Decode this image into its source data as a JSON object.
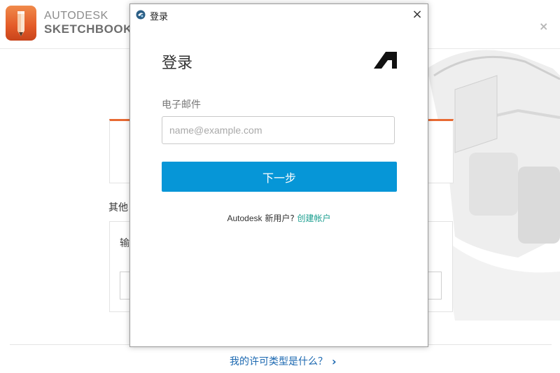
{
  "app": {
    "brand_line1": "AUTODESK",
    "brand_line2": "SKETCHBOOK",
    "close_glyph": "×"
  },
  "background": {
    "other_text": "其他",
    "input_label_fragment": "输",
    "license_link": "我的许可类型是什么？",
    "license_chevron": "›"
  },
  "dialog": {
    "title": "登录",
    "close_glyph": "×",
    "heading": "登录",
    "email_label": "电子邮件",
    "email_placeholder": "name@example.com",
    "email_value": "",
    "next_button": "下一步",
    "signup_brand": "Autodesk",
    "signup_text": "新用户?",
    "signup_link": "创建帐户"
  },
  "colors": {
    "accent_orange": "#e86a33",
    "button_blue": "#0696d7",
    "link_teal": "#1a9e8f",
    "link_blue": "#1a67b0"
  }
}
